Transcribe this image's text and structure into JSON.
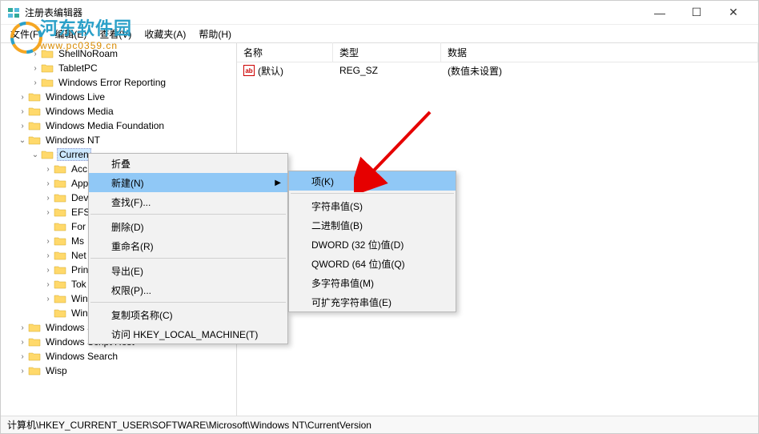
{
  "window": {
    "title": "注册表编辑器",
    "controls": {
      "min": "—",
      "max": "☐",
      "close": "✕"
    }
  },
  "menubar": {
    "file": "文件(F)",
    "edit": "编辑(E)",
    "view": "查看(V)",
    "favorites": "收藏夹(A)",
    "help": "帮助(H)"
  },
  "watermark": {
    "text": "河东软件园",
    "url": "www.pc0359.cn"
  },
  "tree": {
    "items": [
      {
        "label": "ShellNoRoam",
        "indent": 2,
        "exp": "›"
      },
      {
        "label": "TabletPC",
        "indent": 2,
        "exp": "›"
      },
      {
        "label": "Windows Error Reporting",
        "indent": 2,
        "exp": "›"
      },
      {
        "label": "Windows Live",
        "indent": 1,
        "exp": "›"
      },
      {
        "label": "Windows Media",
        "indent": 1,
        "exp": "›"
      },
      {
        "label": "Windows Media Foundation",
        "indent": 1,
        "exp": "›"
      },
      {
        "label": "Windows NT",
        "indent": 1,
        "exp": "⌄"
      },
      {
        "label": "CurrentVersion",
        "indent": 2,
        "exp": "⌄",
        "selected": true,
        "truncated": "Curren"
      },
      {
        "label": "Acc",
        "indent": 3,
        "exp": "›"
      },
      {
        "label": "App",
        "indent": 3,
        "exp": "›"
      },
      {
        "label": "Dev",
        "indent": 3,
        "exp": "›"
      },
      {
        "label": "EFS",
        "indent": 3,
        "exp": "›"
      },
      {
        "label": "For",
        "indent": 3,
        "exp": ""
      },
      {
        "label": "Ms",
        "indent": 3,
        "exp": "›"
      },
      {
        "label": "Net",
        "indent": 3,
        "exp": "›"
      },
      {
        "label": "Prin",
        "indent": 3,
        "exp": "›"
      },
      {
        "label": "Tok",
        "indent": 3,
        "exp": "›"
      },
      {
        "label": "Win",
        "indent": 3,
        "exp": "›"
      },
      {
        "label": "Winlogon",
        "indent": 3,
        "exp": ""
      },
      {
        "label": "Windows Script",
        "indent": 1,
        "exp": "›"
      },
      {
        "label": "Windows Script Host",
        "indent": 1,
        "exp": "›"
      },
      {
        "label": "Windows Search",
        "indent": 1,
        "exp": "›"
      },
      {
        "label": "Wisp",
        "indent": 1,
        "exp": "›"
      }
    ]
  },
  "list": {
    "headers": {
      "name": "名称",
      "type": "类型",
      "data": "数据"
    },
    "rows": [
      {
        "icon": "ab",
        "name": "(默认)",
        "type": "REG_SZ",
        "data": "(数值未设置)"
      }
    ]
  },
  "context_menu_1": {
    "items": [
      {
        "label": "折叠",
        "key": "collapse"
      },
      {
        "label": "新建(N)",
        "key": "new",
        "submenu": true,
        "hover": true
      },
      {
        "label": "查找(F)...",
        "key": "find"
      },
      {
        "sep": true
      },
      {
        "label": "删除(D)",
        "key": "delete"
      },
      {
        "label": "重命名(R)",
        "key": "rename"
      },
      {
        "sep": true
      },
      {
        "label": "导出(E)",
        "key": "export"
      },
      {
        "label": "权限(P)...",
        "key": "permissions"
      },
      {
        "sep": true
      },
      {
        "label": "复制项名称(C)",
        "key": "copykey"
      },
      {
        "label": "访问 HKEY_LOCAL_MACHINE(T)",
        "key": "goto"
      }
    ]
  },
  "context_menu_2": {
    "items": [
      {
        "label": "项(K)",
        "key": "key",
        "hover": true
      },
      {
        "sep": true
      },
      {
        "label": "字符串值(S)",
        "key": "string"
      },
      {
        "label": "二进制值(B)",
        "key": "binary"
      },
      {
        "label": "DWORD (32 位)值(D)",
        "key": "dword"
      },
      {
        "label": "QWORD (64 位)值(Q)",
        "key": "qword"
      },
      {
        "label": "多字符串值(M)",
        "key": "multistring"
      },
      {
        "label": "可扩充字符串值(E)",
        "key": "expandstring"
      }
    ]
  },
  "statusbar": {
    "path": "计算机\\HKEY_CURRENT_USER\\SOFTWARE\\Microsoft\\Windows NT\\CurrentVersion"
  }
}
